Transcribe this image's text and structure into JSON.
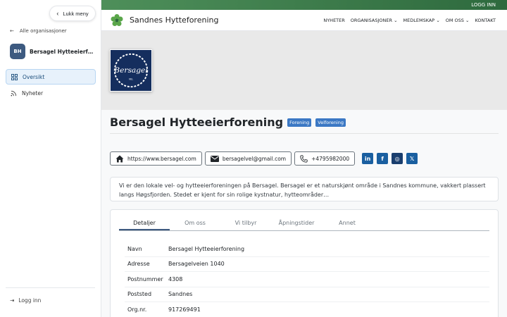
{
  "sidebar": {
    "close_label": "Lukk meny",
    "back_label": "Alle organisasjoner",
    "org_initials": "BH",
    "org_name": "Bersagel Hytteeierforening",
    "nav": [
      {
        "label": "Oversikt",
        "icon": "grid-icon",
        "active": true
      },
      {
        "label": "Nyheter",
        "icon": "rss-icon",
        "active": false
      }
    ],
    "login_label": "Logg inn"
  },
  "topbar": {
    "login_label": "LOGG INN",
    "color_start": "#4e8f5a",
    "color_end": "#2e6a3e"
  },
  "navbar": {
    "site_title": "Sandnes Hytteforening",
    "links": [
      {
        "label": "NYHETER",
        "dropdown": false
      },
      {
        "label": "ORGANISASJONER",
        "dropdown": true
      },
      {
        "label": "MEDLEMSKAP",
        "dropdown": true
      },
      {
        "label": "OM OSS",
        "dropdown": true
      },
      {
        "label": "KONTAKT",
        "dropdown": false
      }
    ]
  },
  "hero": {
    "logo_text": "Bersagel",
    "logo_subtext": "VEL",
    "logo_bg": "#152e5e"
  },
  "org": {
    "title": "Bersagel Hytteeierforening",
    "badges": [
      "Forening",
      "Velforening"
    ],
    "website": "https://www.bersagel.com",
    "email": "bersagelvel@gmail.com",
    "phone": "+4795982000",
    "social": [
      {
        "icon": "linkedin-icon",
        "glyph": "in",
        "color": "#1a5fa0"
      },
      {
        "icon": "facebook-icon",
        "glyph": "f",
        "color": "#1a5fa0"
      },
      {
        "icon": "instagram-icon",
        "glyph": "◎",
        "color": "#1a3e6e"
      },
      {
        "icon": "x-icon",
        "glyph": "𝕏",
        "color": "#1a5fa0"
      }
    ],
    "description": "Vi er den lokale vel- og hytteeierforeningen på Bersagel. Bersagel er et naturskjønt område i Sandnes kommune, vakkert plassert langs Høgsfjorden. Stedet er kjent for sin rolige kystnatur, hytteområder…"
  },
  "tabs": [
    "Detaljer",
    "Om oss",
    "Vi tilbyr",
    "Åpningstider",
    "Annet"
  ],
  "details": [
    {
      "label": "Navn",
      "value": "Bersagel Hytteeierforening"
    },
    {
      "label": "Adresse",
      "value": "Bersagelveien 1040"
    },
    {
      "label": "Postnummer",
      "value": "4308"
    },
    {
      "label": "Poststed",
      "value": "Sandnes"
    },
    {
      "label": "Org.nr.",
      "value": "917269491"
    }
  ]
}
